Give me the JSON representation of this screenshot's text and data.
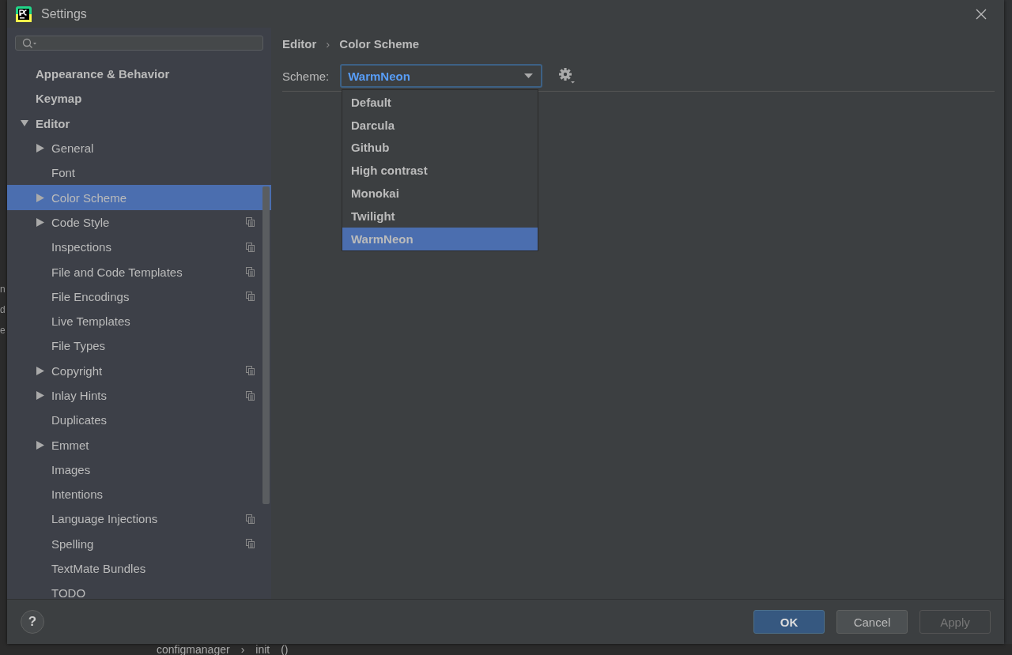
{
  "window": {
    "title": "Settings"
  },
  "background": {
    "left_fragments": [
      "n",
      "d",
      "e"
    ],
    "bottom_texts": [
      "configmanager",
      "›",
      "init",
      "()"
    ]
  },
  "sidebar": {
    "items": [
      {
        "label": "Appearance & Behavior",
        "expanded": false,
        "selected": false
      },
      {
        "label": "Keymap",
        "expanded": false,
        "selected": false
      },
      {
        "label": "Editor",
        "expanded": true,
        "selected": false,
        "children": [
          {
            "label": "General",
            "expandable": true,
            "selected": false,
            "project_level": false
          },
          {
            "label": "Font",
            "expandable": false,
            "selected": false,
            "project_level": false
          },
          {
            "label": "Color Scheme",
            "expandable": true,
            "selected": true,
            "project_level": false
          },
          {
            "label": "Code Style",
            "expandable": true,
            "selected": false,
            "project_level": true
          },
          {
            "label": "Inspections",
            "expandable": false,
            "selected": false,
            "project_level": true
          },
          {
            "label": "File and Code Templates",
            "expandable": false,
            "selected": false,
            "project_level": true
          },
          {
            "label": "File Encodings",
            "expandable": false,
            "selected": false,
            "project_level": true
          },
          {
            "label": "Live Templates",
            "expandable": false,
            "selected": false,
            "project_level": false
          },
          {
            "label": "File Types",
            "expandable": false,
            "selected": false,
            "project_level": false
          },
          {
            "label": "Copyright",
            "expandable": true,
            "selected": false,
            "project_level": true
          },
          {
            "label": "Inlay Hints",
            "expandable": true,
            "selected": false,
            "project_level": true
          },
          {
            "label": "Duplicates",
            "expandable": false,
            "selected": false,
            "project_level": false
          },
          {
            "label": "Emmet",
            "expandable": true,
            "selected": false,
            "project_level": false
          },
          {
            "label": "Images",
            "expandable": false,
            "selected": false,
            "project_level": false
          },
          {
            "label": "Intentions",
            "expandable": false,
            "selected": false,
            "project_level": false
          },
          {
            "label": "Language Injections",
            "expandable": false,
            "selected": false,
            "project_level": true
          },
          {
            "label": "Spelling",
            "expandable": false,
            "selected": false,
            "project_level": true
          },
          {
            "label": "TextMate Bundles",
            "expandable": false,
            "selected": false,
            "project_level": false
          },
          {
            "label": "TODO",
            "expandable": false,
            "selected": false,
            "project_level": false
          }
        ]
      }
    ]
  },
  "breadcrumb": [
    "Editor",
    "›",
    "Color Scheme"
  ],
  "scheme": {
    "label": "Scheme:",
    "value": "WarmNeon",
    "options": [
      {
        "label": "Default",
        "selected": false
      },
      {
        "label": "Darcula",
        "selected": false
      },
      {
        "label": "Github",
        "selected": false
      },
      {
        "label": "High contrast",
        "selected": false
      },
      {
        "label": "Monokai",
        "selected": false
      },
      {
        "label": "Twilight",
        "selected": false
      },
      {
        "label": "WarmNeon",
        "selected": true
      }
    ]
  },
  "footer": {
    "help": "?",
    "buttons": [
      {
        "label": "OK",
        "kind": "primary",
        "disabled": false
      },
      {
        "label": "Cancel",
        "kind": "normal",
        "disabled": false
      },
      {
        "label": "Apply",
        "kind": "normal",
        "disabled": true
      }
    ]
  }
}
